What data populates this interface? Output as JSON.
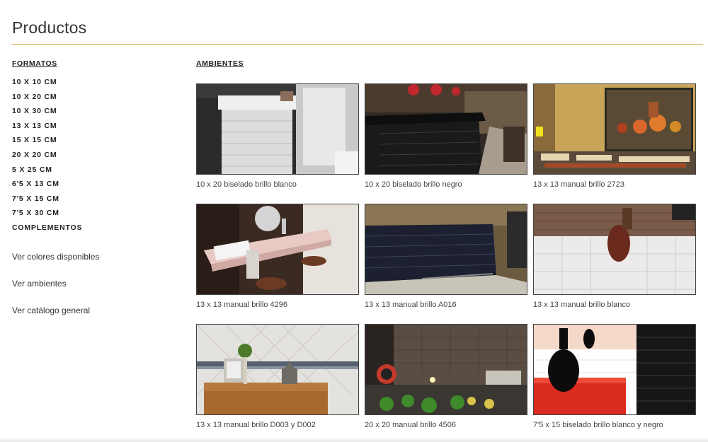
{
  "page": {
    "title": "Productos"
  },
  "sidebar": {
    "heading": "FORMATOS",
    "formats": [
      "10 X 10 CM",
      "10 X 20 CM",
      "10 X 30 CM",
      "13 X 13 CM",
      "15 X 15 CM",
      "20 X 20 CM",
      "5 X 25 CM",
      "6'5 X 13 CM",
      "7'5 X 15 CM",
      "7'5 X 30 CM",
      "COMPLEMENTOS"
    ],
    "links": [
      "Ver colores disponibles",
      "Ver ambientes",
      "Ver catálogo general"
    ]
  },
  "main": {
    "heading": "AMBIENTES",
    "items": [
      {
        "caption": "10 x 20 biselado brillo blanco"
      },
      {
        "caption": "10 x 20 biselado brillo negro"
      },
      {
        "caption": "13 x 13 manual brillo 2723"
      },
      {
        "caption": "13 x 13 manual brillo 4296"
      },
      {
        "caption": "13 x 13 manual brillo A016"
      },
      {
        "caption": "13 x 13 manual brillo blanco"
      },
      {
        "caption": "13 x 13 manual brillo D003 y D002"
      },
      {
        "caption": "20 x 20 manual brillo 4506"
      },
      {
        "caption": "7'5 x 15 biselado brillo blanco y negro"
      }
    ]
  },
  "theme": {
    "accent": "#d9a441",
    "text": "#222222"
  }
}
